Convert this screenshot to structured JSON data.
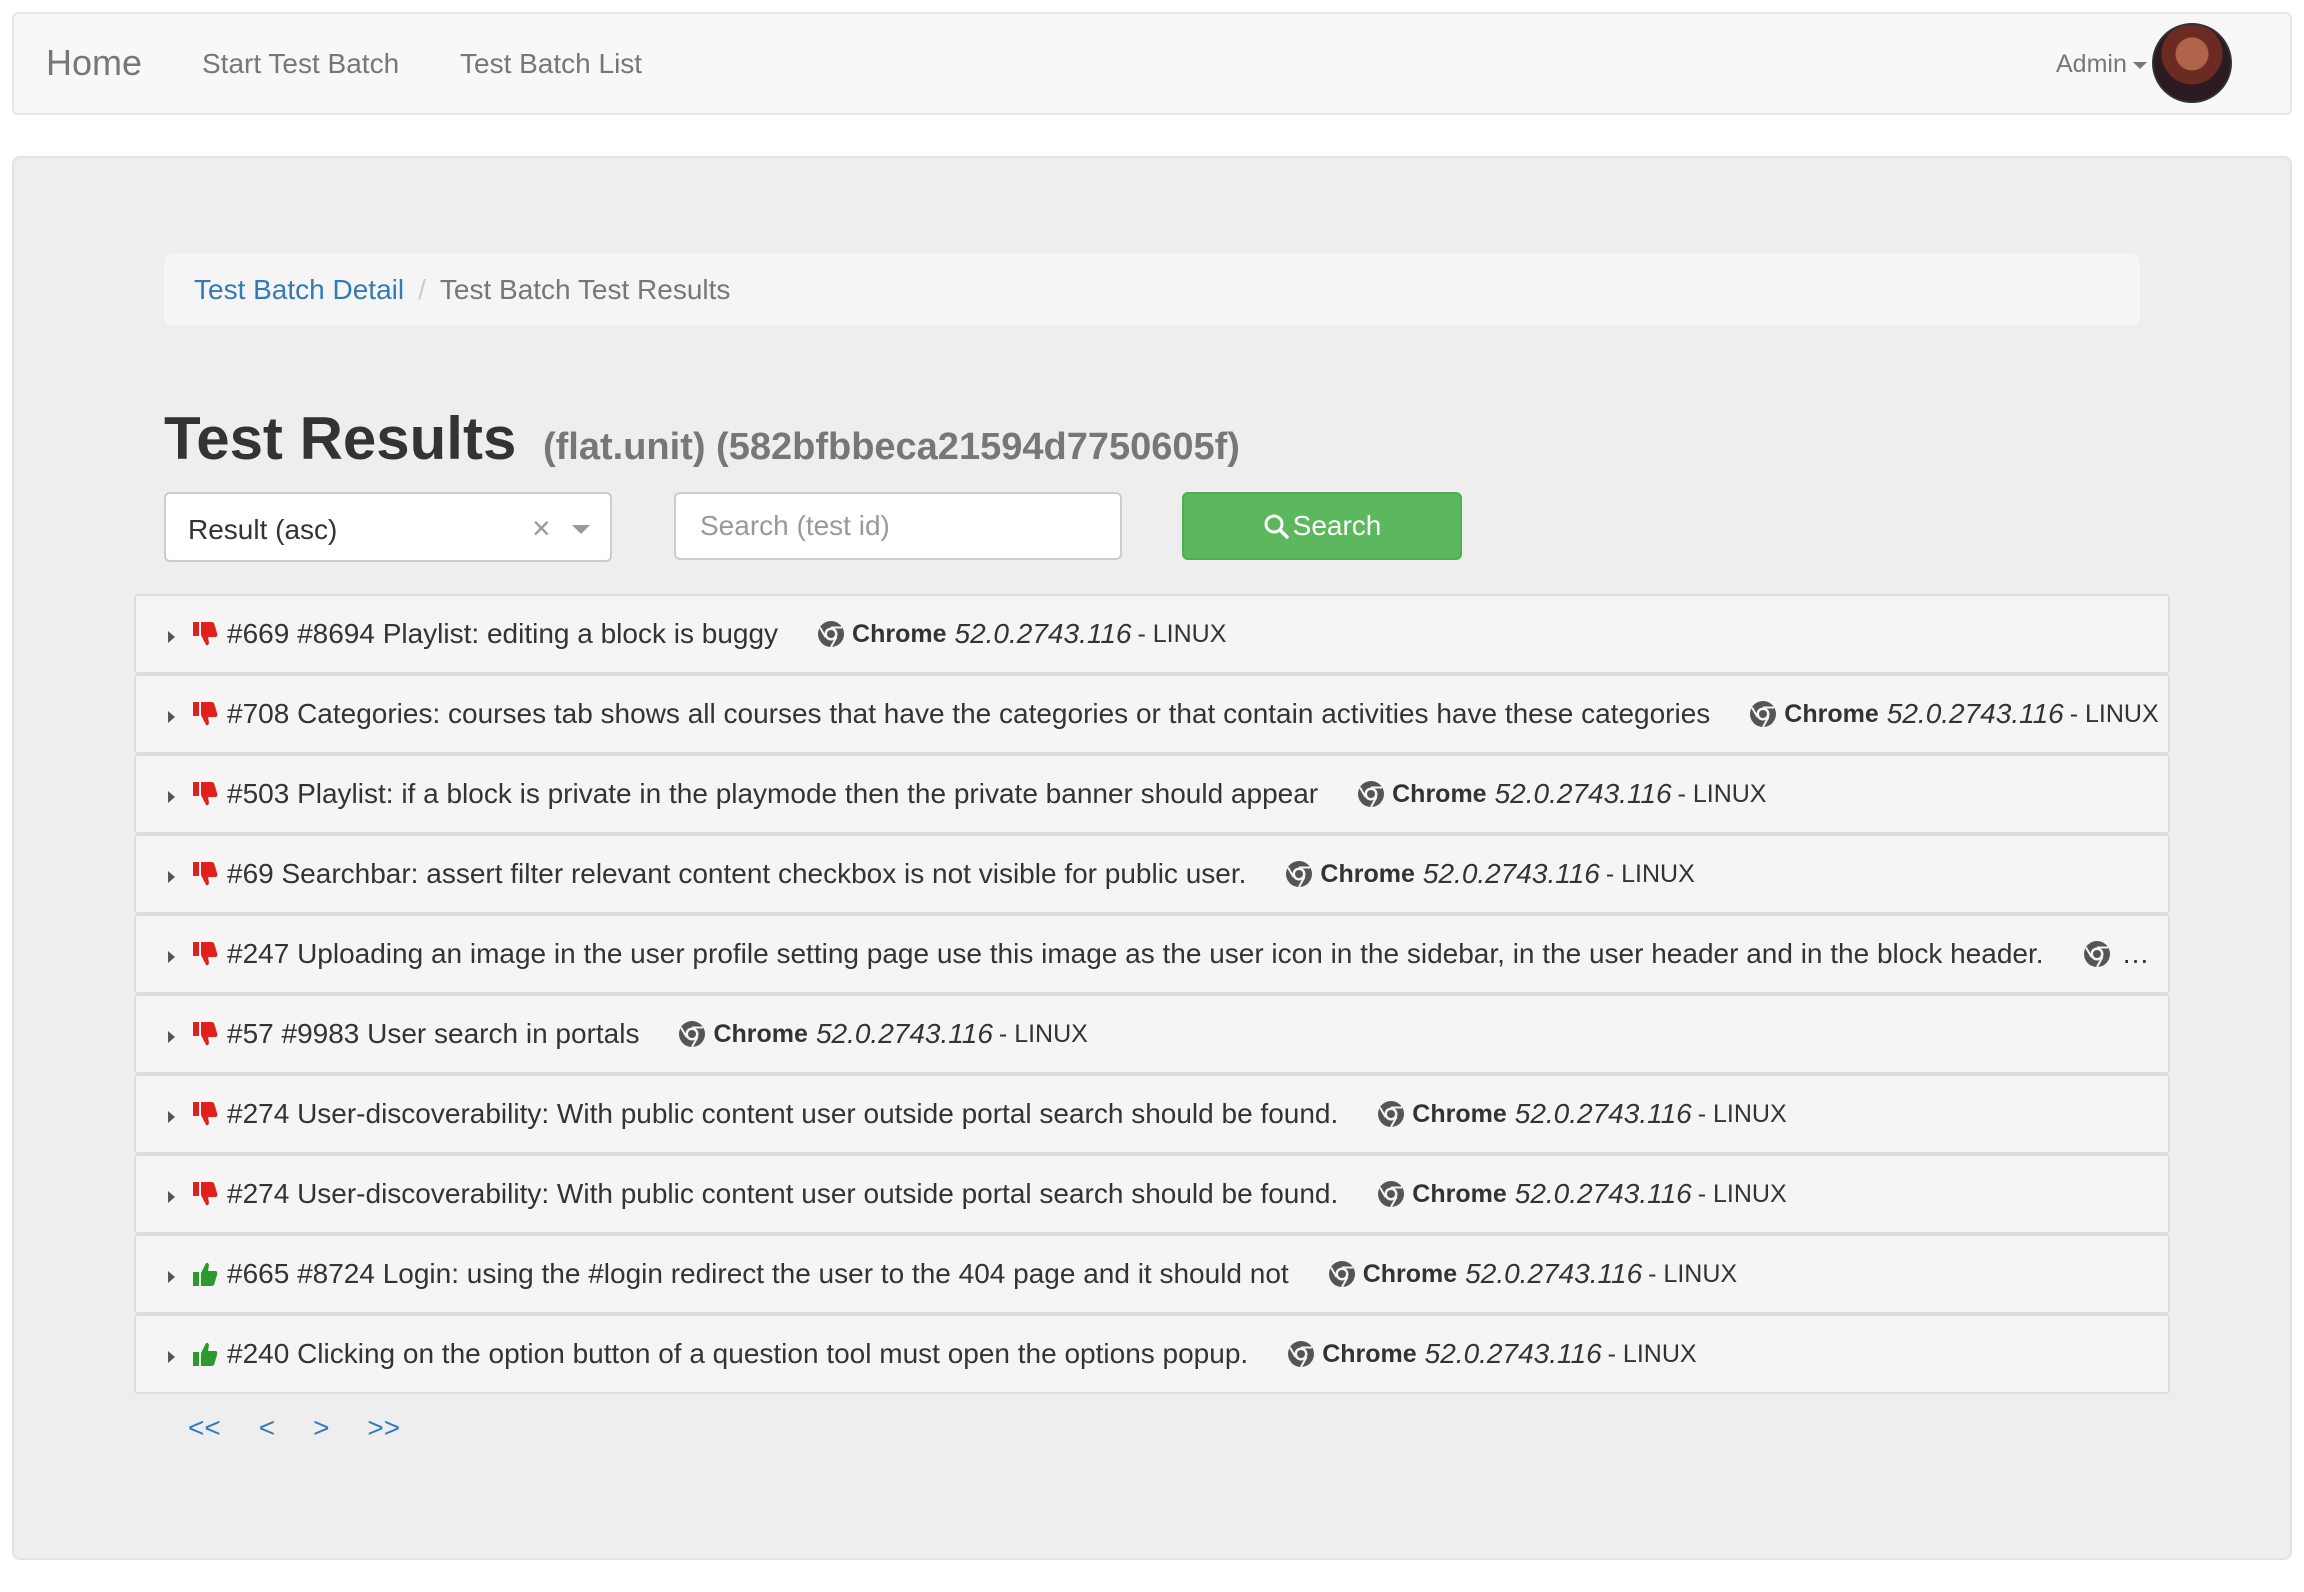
{
  "navbar": {
    "brand": "Home",
    "links": [
      "Start Test Batch",
      "Test Batch List"
    ],
    "user": "Admin"
  },
  "breadcrumb": {
    "link": "Test Batch Detail",
    "separator": "/",
    "active": "Test Batch Test Results"
  },
  "page": {
    "title": "Test Results",
    "subtitle": "(flat.unit) (582bfbbeca21594d7750605f)"
  },
  "filters": {
    "sort_value": "Result (asc)",
    "clear_glyph": "×",
    "search_placeholder": "Search (test id)",
    "search_button": "Search"
  },
  "results": [
    {
      "status": "fail",
      "text": "#669 #8694 Playlist: editing a block is buggy",
      "browser": "Chrome",
      "version": "52.0.2743.116",
      "os": "- LINUX"
    },
    {
      "status": "fail",
      "text": "#708 Categories: courses tab shows all courses that have the categories or that contain activities have these categories",
      "browser": "Chrome",
      "version": "52.0.2743.116",
      "os": "- LINUX"
    },
    {
      "status": "fail",
      "text": "#503 Playlist: if a block is private in the playmode then the private banner should appear",
      "browser": "Chrome",
      "version": "52.0.2743.116",
      "os": "- LINUX"
    },
    {
      "status": "fail",
      "text": "#69 Searchbar: assert filter relevant content checkbox is not visible for public user.",
      "browser": "Chrome",
      "version": "52.0.2743.116",
      "os": "- LINUX"
    },
    {
      "status": "fail",
      "text": "#247 Uploading an image in the user profile setting page use this image as the user icon in the sidebar, in the user header and in the block header.",
      "truncated": "…"
    },
    {
      "status": "fail",
      "text": "#57 #9983 User search in portals",
      "browser": "Chrome",
      "version": "52.0.2743.116",
      "os": "- LINUX"
    },
    {
      "status": "fail",
      "text": "#274 User-discoverability: With public content user outside portal search should be found.",
      "browser": "Chrome",
      "version": "52.0.2743.116",
      "os": "- LINUX"
    },
    {
      "status": "fail",
      "text": "#274 User-discoverability: With public content user outside portal search should be found.",
      "browser": "Chrome",
      "version": "52.0.2743.116",
      "os": "- LINUX"
    },
    {
      "status": "pass",
      "text": "#665 #8724 Login: using the #login redirect the user to the 404 page and it should not",
      "browser": "Chrome",
      "version": "52.0.2743.116",
      "os": "- LINUX"
    },
    {
      "status": "pass",
      "text": "#240 Clicking on the option button of a question tool must open the options popup.",
      "browser": "Chrome",
      "version": "52.0.2743.116",
      "os": "- LINUX"
    }
  ],
  "pagination": [
    "<<",
    "<",
    ">",
    ">>"
  ],
  "colors": {
    "fail": "#e0201b",
    "pass": "#2e9a2e",
    "link": "#337ab7",
    "search_button": "#5cb85c"
  },
  "icons": {
    "fail": "thumbs-down-icon",
    "pass": "thumbs-up-icon",
    "browser": "chrome-icon",
    "search": "search-icon"
  }
}
